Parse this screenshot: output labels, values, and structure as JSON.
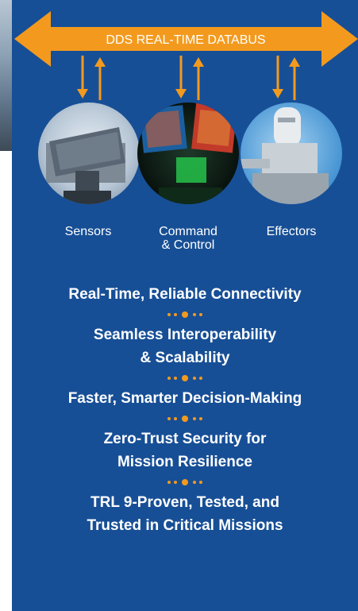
{
  "bus": {
    "label": "DDS REAL-TIME DATABUS"
  },
  "nodes": [
    {
      "label": "Sensors"
    },
    {
      "label_line1": "Command",
      "label_line2": "& Control"
    },
    {
      "label": "Effectors"
    }
  ],
  "features": [
    "Real-Time, Reliable Connectivity",
    "Seamless Interoperability\n& Scalability",
    "Faster, Smarter Decision-Making",
    "Zero-Trust Security for\nMission Resilience",
    "TRL 9-Proven, Tested, and\nTrusted in Critical Missions"
  ],
  "colors": {
    "panel": "#174f96",
    "accent": "#f39a1e",
    "text": "#ffffff"
  }
}
